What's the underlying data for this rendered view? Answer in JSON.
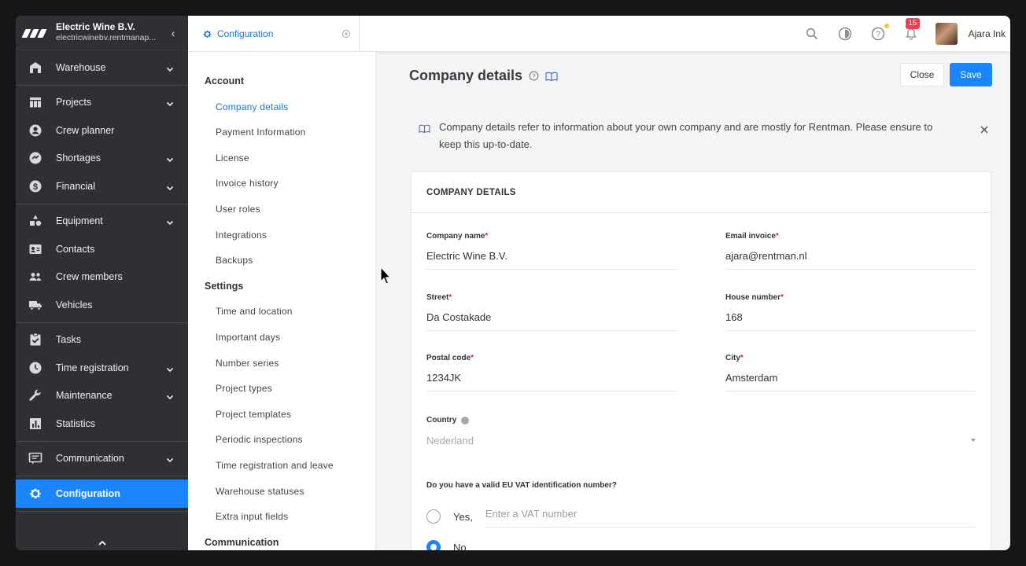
{
  "app": {
    "org_name": "Electric Wine B.V.",
    "org_domain": "electricwinebv.rentmanap..."
  },
  "nav": {
    "groups": [
      [
        {
          "label": "Warehouse",
          "icon": "warehouse-icon",
          "expandable": true
        }
      ],
      [
        {
          "label": "Projects",
          "icon": "projects-icon",
          "expandable": true
        },
        {
          "label": "Crew planner",
          "icon": "crew-planner-icon",
          "expandable": false
        },
        {
          "label": "Shortages",
          "icon": "shortages-icon",
          "expandable": true
        },
        {
          "label": "Financial",
          "icon": "dollar-icon",
          "expandable": true
        }
      ],
      [
        {
          "label": "Equipment",
          "icon": "equipment-icon",
          "expandable": true
        },
        {
          "label": "Contacts",
          "icon": "contacts-icon",
          "expandable": false
        },
        {
          "label": "Crew members",
          "icon": "crew-members-icon",
          "expandable": false
        },
        {
          "label": "Vehicles",
          "icon": "truck-icon",
          "expandable": false
        }
      ],
      [
        {
          "label": "Tasks",
          "icon": "tasks-icon",
          "expandable": false
        },
        {
          "label": "Time registration",
          "icon": "clock-icon",
          "expandable": true
        },
        {
          "label": "Maintenance",
          "icon": "wrench-icon",
          "expandable": true
        },
        {
          "label": "Statistics",
          "icon": "statistics-icon",
          "expandable": false
        }
      ],
      [
        {
          "label": "Communication",
          "icon": "communication-icon",
          "expandable": true
        }
      ],
      [
        {
          "label": "Configuration",
          "icon": "gear-icon",
          "expandable": false,
          "active": true
        }
      ]
    ]
  },
  "tab": {
    "label": "Configuration"
  },
  "topbar": {
    "notification_count": "15",
    "user_name": "Ajara Ink"
  },
  "subnav": {
    "sections": [
      {
        "title": "Account",
        "items": [
          "Company details",
          "Payment Information",
          "License",
          "Invoice history",
          "User roles",
          "Integrations",
          "Backups"
        ]
      },
      {
        "title": "Settings",
        "items": [
          "Time and location",
          "Important days",
          "Number series",
          "Project types",
          "Project templates",
          "Periodic inspections",
          "Time registration and leave",
          "Warehouse statuses",
          "Extra input fields"
        ]
      },
      {
        "title": "Communication",
        "items": []
      }
    ],
    "active": "Company details"
  },
  "main": {
    "title": "Company details",
    "close_label": "Close",
    "save_label": "Save",
    "banner": "Company details refer to information about your own company and are mostly for Rentman. Please ensure to keep this up-to-date.",
    "card_title": "COMPANY DETAILS",
    "fields": {
      "company_name": {
        "label": "Company name",
        "value": "Electric Wine B.V."
      },
      "email_invoice": {
        "label": "Email invoice",
        "value": "ajara@rentman.nl"
      },
      "street": {
        "label": "Street",
        "value": "Da Costakade"
      },
      "house_number": {
        "label": "House number",
        "value": "168"
      },
      "postal_code": {
        "label": "Postal code",
        "value": "1234JK"
      },
      "city": {
        "label": "City",
        "value": "Amsterdam"
      },
      "country": {
        "label": "Country",
        "value": "Nederland"
      }
    },
    "vat_question": "Do you have a valid EU VAT identification number?",
    "vat_yes": "Yes,",
    "vat_placeholder": "Enter a VAT number",
    "vat_no": "No",
    "vat_selected": "No"
  },
  "colors": {
    "accent": "#1a85ff",
    "nav_bg": "#2f3033",
    "badge": "#ee3d55"
  }
}
